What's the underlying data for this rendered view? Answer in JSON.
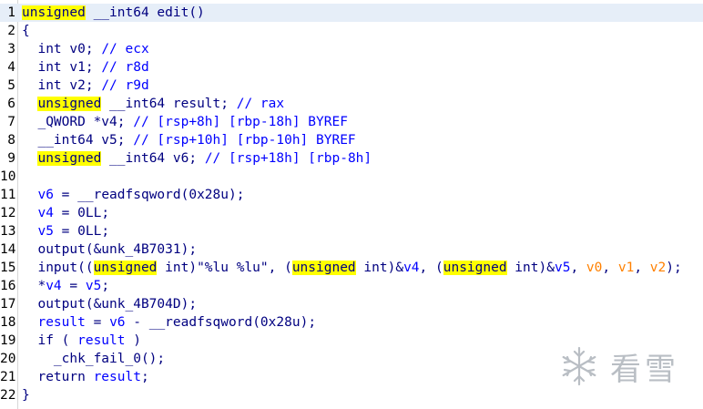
{
  "lines": [
    {
      "n": "1",
      "current": true,
      "tokens": [
        [
          "unsigned",
          "hl"
        ],
        [
          " __int64 edit()",
          "code"
        ]
      ]
    },
    {
      "n": "2",
      "tokens": [
        [
          "{",
          "br"
        ]
      ]
    },
    {
      "n": "3",
      "tokens": [
        [
          "  int v0; ",
          "code"
        ],
        [
          "// ecx",
          "cmt"
        ]
      ]
    },
    {
      "n": "4",
      "tokens": [
        [
          "  int v1; ",
          "code"
        ],
        [
          "// r8d",
          "cmt"
        ]
      ]
    },
    {
      "n": "5",
      "tokens": [
        [
          "  int v2; ",
          "code"
        ],
        [
          "// r9d",
          "cmt"
        ]
      ]
    },
    {
      "n": "6",
      "tokens": [
        [
          "  ",
          "code"
        ],
        [
          "unsigned",
          "hl"
        ],
        [
          " __int64 result; ",
          "code"
        ],
        [
          "// rax",
          "cmt"
        ]
      ]
    },
    {
      "n": "7",
      "tokens": [
        [
          "  _QWORD *v4; ",
          "code"
        ],
        [
          "// [rsp+8h] [rbp-18h] BYREF",
          "cmt"
        ]
      ]
    },
    {
      "n": "8",
      "tokens": [
        [
          "  __int64 v5; ",
          "code"
        ],
        [
          "// [rsp+10h] [rbp-10h] BYREF",
          "cmt"
        ]
      ]
    },
    {
      "n": "9",
      "tokens": [
        [
          "  ",
          "code"
        ],
        [
          "unsigned",
          "hl"
        ],
        [
          " __int64 v6; ",
          "code"
        ],
        [
          "// [rsp+18h] [rbp-8h]",
          "cmt"
        ]
      ]
    },
    {
      "n": "10",
      "tokens": []
    },
    {
      "n": "11",
      "tokens": [
        [
          "  ",
          "code"
        ],
        [
          "v6",
          "var"
        ],
        [
          " = __readfsqword(0x28u);",
          "code"
        ]
      ]
    },
    {
      "n": "12",
      "tokens": [
        [
          "  ",
          "code"
        ],
        [
          "v4",
          "var"
        ],
        [
          " = 0LL;",
          "code"
        ]
      ]
    },
    {
      "n": "13",
      "tokens": [
        [
          "  ",
          "code"
        ],
        [
          "v5",
          "var"
        ],
        [
          " = 0LL;",
          "code"
        ]
      ]
    },
    {
      "n": "14",
      "tokens": [
        [
          "  output(&unk_4B7031);",
          "code"
        ]
      ]
    },
    {
      "n": "15",
      "tokens": [
        [
          "  input((",
          "code"
        ],
        [
          "unsigned",
          "hl"
        ],
        [
          " int)\"%lu %lu\", (",
          "code"
        ],
        [
          "unsigned",
          "hl"
        ],
        [
          " int)&",
          "code"
        ],
        [
          "v4",
          "var"
        ],
        [
          ", (",
          "code"
        ],
        [
          "unsigned",
          "hl"
        ],
        [
          " int)&",
          "code"
        ],
        [
          "v5",
          "var"
        ],
        [
          ", ",
          "code"
        ],
        [
          "v0",
          "arg"
        ],
        [
          ", ",
          "code"
        ],
        [
          "v1",
          "arg"
        ],
        [
          ", ",
          "code"
        ],
        [
          "v2",
          "arg"
        ],
        [
          ");",
          "code"
        ]
      ]
    },
    {
      "n": "16",
      "tokens": [
        [
          "  *",
          "code"
        ],
        [
          "v4",
          "var"
        ],
        [
          " = ",
          "code"
        ],
        [
          "v5",
          "var"
        ],
        [
          ";",
          "code"
        ]
      ]
    },
    {
      "n": "17",
      "tokens": [
        [
          "  output(&unk_4B704D);",
          "code"
        ]
      ]
    },
    {
      "n": "18",
      "tokens": [
        [
          "  ",
          "code"
        ],
        [
          "result",
          "var"
        ],
        [
          " = ",
          "code"
        ],
        [
          "v6",
          "var"
        ],
        [
          " - __readfsqword(0x28u);",
          "code"
        ]
      ]
    },
    {
      "n": "19",
      "tokens": [
        [
          "  if ( ",
          "code"
        ],
        [
          "result",
          "var"
        ],
        [
          " )",
          "code"
        ]
      ]
    },
    {
      "n": "20",
      "tokens": [
        [
          "    _chk_fail_0();",
          "code"
        ]
      ]
    },
    {
      "n": "21",
      "tokens": [
        [
          "  return ",
          "code"
        ],
        [
          "result",
          "var"
        ],
        [
          ";",
          "code"
        ]
      ]
    },
    {
      "n": "22",
      "tokens": [
        [
          "}",
          "br"
        ]
      ]
    }
  ],
  "watermark": {
    "text": "看雪",
    "icon": "snowflake-icon"
  },
  "colors": {
    "keyword_highlight": "#ffff00",
    "comment": "#0000ff",
    "variable": "#0000ff",
    "argument": "#ff8000",
    "code": "#000080",
    "current_line": "#e6eef8"
  }
}
